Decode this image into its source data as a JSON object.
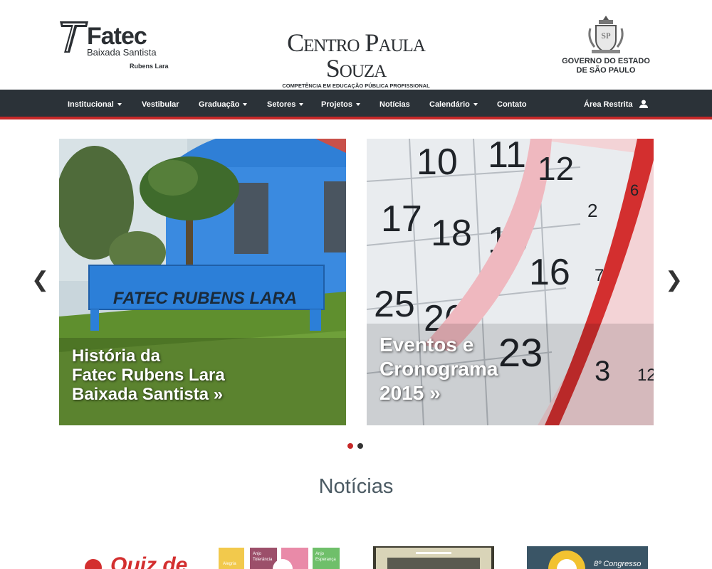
{
  "header": {
    "fatec": {
      "name": "Fatec",
      "sub": "Baixada Santista",
      "unit": "Rubens Lara"
    },
    "cps": {
      "name": "Centro Paula Souza",
      "tagline": "COMPETÊNCIA EM EDUCAÇÃO PÚBLICA PROFISSIONAL"
    },
    "gov": {
      "line1": "GOVERNO DO ESTADO",
      "line2": "DE SÃO PAULO"
    }
  },
  "nav": {
    "items": [
      {
        "label": "Institucional",
        "dropdown": true
      },
      {
        "label": "Vestibular",
        "dropdown": false
      },
      {
        "label": "Graduação",
        "dropdown": true
      },
      {
        "label": "Setores",
        "dropdown": true
      },
      {
        "label": "Projetos",
        "dropdown": true
      },
      {
        "label": "Notícias",
        "dropdown": false
      },
      {
        "label": "Calendário",
        "dropdown": true
      },
      {
        "label": "Contato",
        "dropdown": false
      }
    ],
    "restricted": "Área Restrita"
  },
  "carousel": {
    "prev": "❮",
    "next": "❯",
    "slides": [
      {
        "caption_line1": "História da",
        "caption_line2": "Fatec Rubens Lara",
        "caption_line3": "Baixada Santista »",
        "sign_text": "FATEC RUBENS LARA"
      },
      {
        "caption_line1": "Eventos e",
        "caption_line2": "Cronograma",
        "caption_line3": "2015 »"
      }
    ],
    "active_index": 0
  },
  "news": {
    "title": "Notícias",
    "thumb1_text": "Quiz de",
    "thumb2_labels": [
      "Alegria",
      "Anjo",
      "Tolerância",
      "Anjo",
      "Esperança"
    ],
    "thumb4_text": "8º Congresso"
  },
  "colors": {
    "nav_bg": "#2b3238",
    "accent": "#c62828",
    "dark_text": "#2b2f33"
  }
}
